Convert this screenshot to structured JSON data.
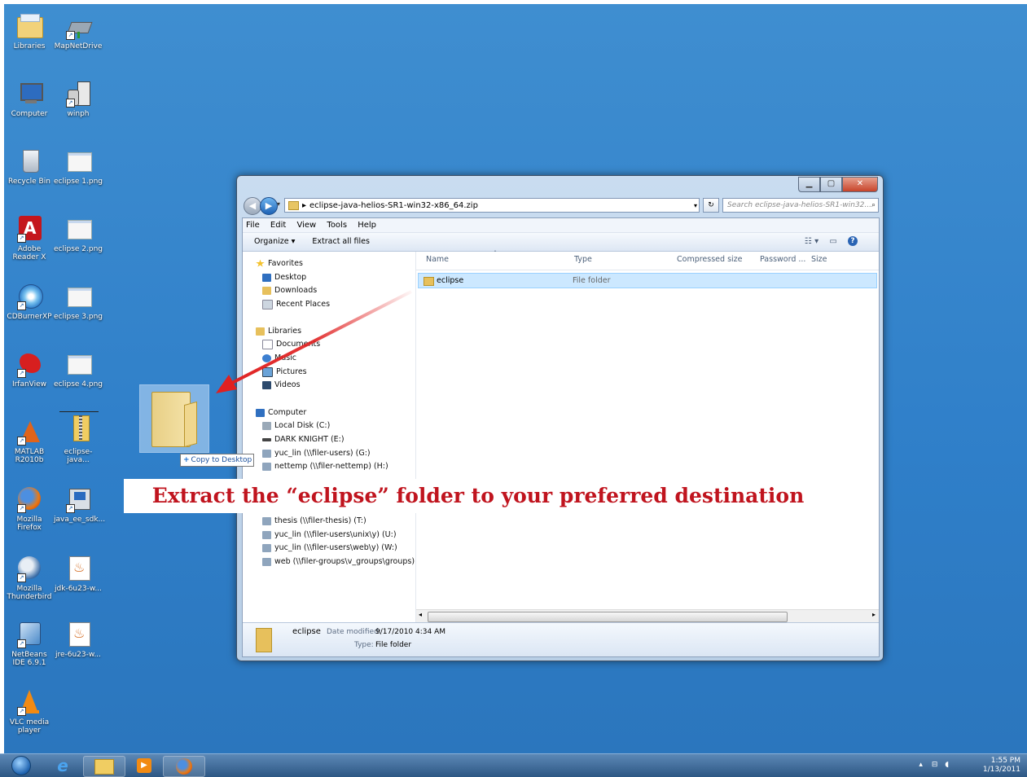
{
  "desktop_icons": [
    {
      "label": "Libraries"
    },
    {
      "label": "MapNetDrive"
    },
    {
      "label": "Computer"
    },
    {
      "label": "winph"
    },
    {
      "label": "Recycle Bin"
    },
    {
      "label": "eclipse 1.png"
    },
    {
      "label": "Adobe Reader X"
    },
    {
      "label": "eclipse 2.png"
    },
    {
      "label": "CDBurnerXP"
    },
    {
      "label": "eclipse 3.png"
    },
    {
      "label": "IrfanView"
    },
    {
      "label": "eclipse 4.png"
    },
    {
      "label": "MATLAB R2010b"
    },
    {
      "label": "eclipse-java..."
    },
    {
      "label": "Mozilla Firefox"
    },
    {
      "label": "java_ee_sdk..."
    },
    {
      "label": "Mozilla Thunderbird"
    },
    {
      "label": "jdk-6u23-w..."
    },
    {
      "label": "NetBeans IDE 6.9.1"
    },
    {
      "label": "jre-6u23-w..."
    },
    {
      "label": "VLC media player"
    }
  ],
  "window": {
    "address": "eclipse-java-helios-SR1-win32-x86_64.zip",
    "search_placeholder": "Search eclipse-java-helios-SR1-win32...",
    "menu": [
      "File",
      "Edit",
      "View",
      "Tools",
      "Help"
    ],
    "toolbar": {
      "organize": "Organize ▾",
      "extract": "Extract all files"
    },
    "nav": {
      "favorites": "Favorites",
      "desktop": "Desktop",
      "downloads": "Downloads",
      "recent": "Recent Places",
      "libraries": "Libraries",
      "documents": "Documents",
      "music": "Music",
      "pictures": "Pictures",
      "videos": "Videos",
      "computer": "Computer",
      "drives": [
        "Local Disk (C:)",
        "DARK KNIGHT (E:)",
        "yuc_lin (\\\\filer-users) (G:)",
        "nettemp (\\\\filer-nettemp) (H:)",
        "thesis (\\\\filer-thesis) (T:)",
        "yuc_lin (\\\\filer-users\\unix\\y) (U:)",
        "yuc_lin (\\\\filer-users\\web\\y) (W:)",
        "web (\\\\filer-groups\\v_groups\\groups) (X"
      ]
    },
    "columns": [
      "Name",
      "Type",
      "Compressed size",
      "Password ...",
      "Size"
    ],
    "rows": [
      {
        "name": "eclipse",
        "type": "File folder"
      }
    ],
    "details": {
      "name": "eclipse",
      "date_label": "Date modified:",
      "date_value": "9/17/2010 4:34 AM",
      "type_label": "Type:",
      "type_value": "File folder"
    }
  },
  "drag": {
    "tooltip": "Copy to Desktop"
  },
  "instruction": "Extract the “eclipse” folder to your preferred destination",
  "taskbar": {
    "time": "1:55 PM",
    "date": "1/13/2011"
  },
  "colors": {
    "desktop": "#3b88cc",
    "instruction_text": "#c0141e",
    "arrow": "#e02020",
    "selection": "#cce8ff"
  }
}
